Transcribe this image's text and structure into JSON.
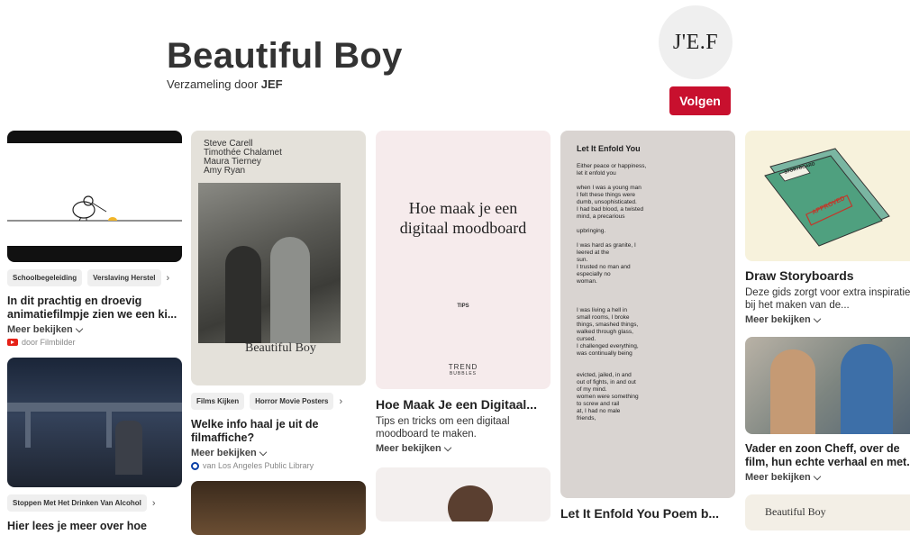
{
  "board": {
    "title": "Beautiful Boy",
    "subtitle_prefix": "Verzameling door ",
    "owner": "JEF",
    "avatar_text": "J'E.F",
    "follow_label": "Volgen"
  },
  "pins": [
    {
      "tags": [
        "Schoolbegeleiding",
        "Verslaving Herstel"
      ],
      "title": "In dit prachtig en droevig animatiefilmpje zien we een ki...",
      "more": "Meer bekijken",
      "source": "door Filmbilder"
    },
    {
      "tags": [
        "Films Kijken",
        "Horror Movie Posters"
      ],
      "title": "Welke info haal je uit de filmaffiche?",
      "more": "Meer bekijken",
      "source": "van Los Angeles Public Library",
      "poster_names": [
        "Steve Carell",
        "Timothée Chalamet",
        "Maura Tierney",
        "Amy Ryan"
      ],
      "poster_title": "Beautiful Boy"
    },
    {
      "image_text": "Hoe maak je een digitaal moodboard",
      "image_small": "TIPS",
      "image_brand": "TREND",
      "image_brand_sub": "BUBBLES",
      "title": "Hoe Maak Je een Digitaal...",
      "desc": "Tips en tricks om een digitaal moodboard te maken.",
      "more": "Meer bekijken"
    },
    {
      "poem_title": "Let It Enfold You",
      "poem_lines": "Either peace or happiness,\nlet it enfold you\n\nwhen I was a young man\nI felt these things were\ndumb, unsophisticated.\nI had bad blood, a twisted\nmind, a precarious\n\nupbringing.\n\nI was hard as granite, I\nleered at the\nsun.\nI trusted no man and\nespecially no\nwoman.\n\n\n\nI was living a hell in\nsmall rooms, I broke\nthings, smashed things,\nwalked through glass,\ncursed.\nI challenged everything,\nwas continually being\n\n\nevicted, jailed, in and\nout of fights, in and out\nof my mind.\nwomen were something\nto screw and rail\nat, I had no male\nfriends,",
      "title": "Let It Enfold You Poem b..."
    },
    {
      "title": "Draw Storyboards",
      "desc": "Deze gids zorgt voor extra inspiratie bij het maken van de...",
      "more": "Meer bekijken",
      "folder_label": "STORYBOARD",
      "stamp": "APPROVED"
    },
    {
      "title": "Vader en zoon Cheff, over de film, hun echte verhaal en met...",
      "more": "Meer bekijken",
      "next_card_text": "Beautiful Boy"
    }
  ],
  "second_row": {
    "tags": [
      "Stoppen Met Het Drinken Van Alcohol"
    ],
    "title": "Hier lees je meer over hoe"
  }
}
